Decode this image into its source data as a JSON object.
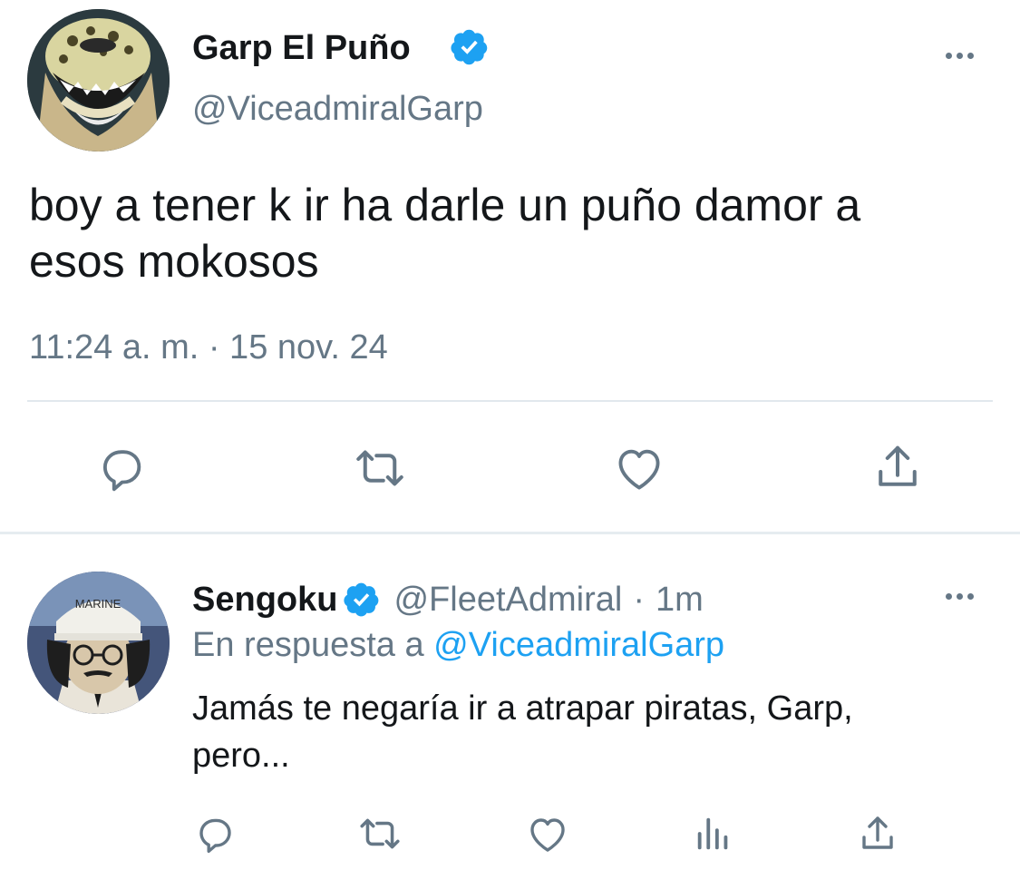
{
  "main_tweet": {
    "author_name": "Garp El Puño",
    "handle": "@ViceadmiralGarp",
    "text_line1": "boy a tener k ir ha darle un puño damor a",
    "text_line2": "esos mokosos",
    "timestamp": "11:24 a. m. · 15 nov. 24",
    "verified": true,
    "actions": [
      "reply-icon",
      "retweet-icon",
      "like-icon",
      "share-icon"
    ]
  },
  "reply_tweet": {
    "author_name": "Sengoku",
    "handle": "@FleetAdmiral",
    "time_sep": "·",
    "time": "1m",
    "reply_prefix": "En respuesta a",
    "reply_to": "@ViceadmiralGarp",
    "text_line1": "Jamás te negaría ir a atrapar piratas, Garp,",
    "text_line2": "pero...",
    "avatar_cap_text": "MARINE",
    "verified": true,
    "actions": [
      "reply-icon",
      "retweet-icon",
      "like-icon",
      "analytics-icon",
      "share-icon"
    ]
  },
  "colors": {
    "verified": "#1da1f2",
    "muted": "#657786",
    "link": "#1da1f2",
    "icon": "#657786",
    "divider": "#e1e8ed"
  }
}
